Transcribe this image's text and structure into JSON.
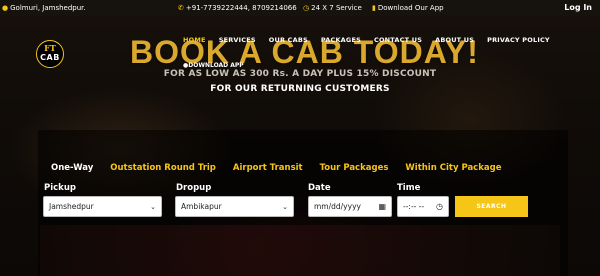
{
  "topbar": {
    "location": "Golmuri, Jamshedpur.",
    "phone": "+91-7739222444, 8709214066",
    "service": "24 X 7 Service",
    "download": "Download Our App",
    "login": "Log In"
  },
  "logo": {
    "top": "FT",
    "bottom": "CAB"
  },
  "headline": "BOOK A CAB TODAY!",
  "nav": [
    "HOME",
    "SERVICES",
    "OUR CABS",
    "PACKAGES",
    "CONTACT US",
    "ABOUT US",
    "PRIVACY POLICY"
  ],
  "download_app": "DOWNLOAD APP",
  "promo": {
    "line1": "FOR AS LOW AS 300 Rs. A DAY PLUS 15% DISCOUNT",
    "line2": "FOR OUR RETURNING CUSTOMERS"
  },
  "tabs": [
    "One-Way",
    "Outstation Round Trip",
    "Airport Transit",
    "Tour Packages",
    "Within City Package"
  ],
  "form": {
    "pickup_label": "Pickup",
    "pickup_value": "Jamshedpur",
    "dropup_label": "Dropup",
    "dropup_value": "Ambikapur",
    "date_label": "Date",
    "date_value": "mm/dd/yyyy",
    "time_label": "Time",
    "time_value": "--:-- --",
    "search_label": "SEARCH"
  },
  "colors": {
    "accent": "#f5c518",
    "headline": "#d9a82c"
  }
}
